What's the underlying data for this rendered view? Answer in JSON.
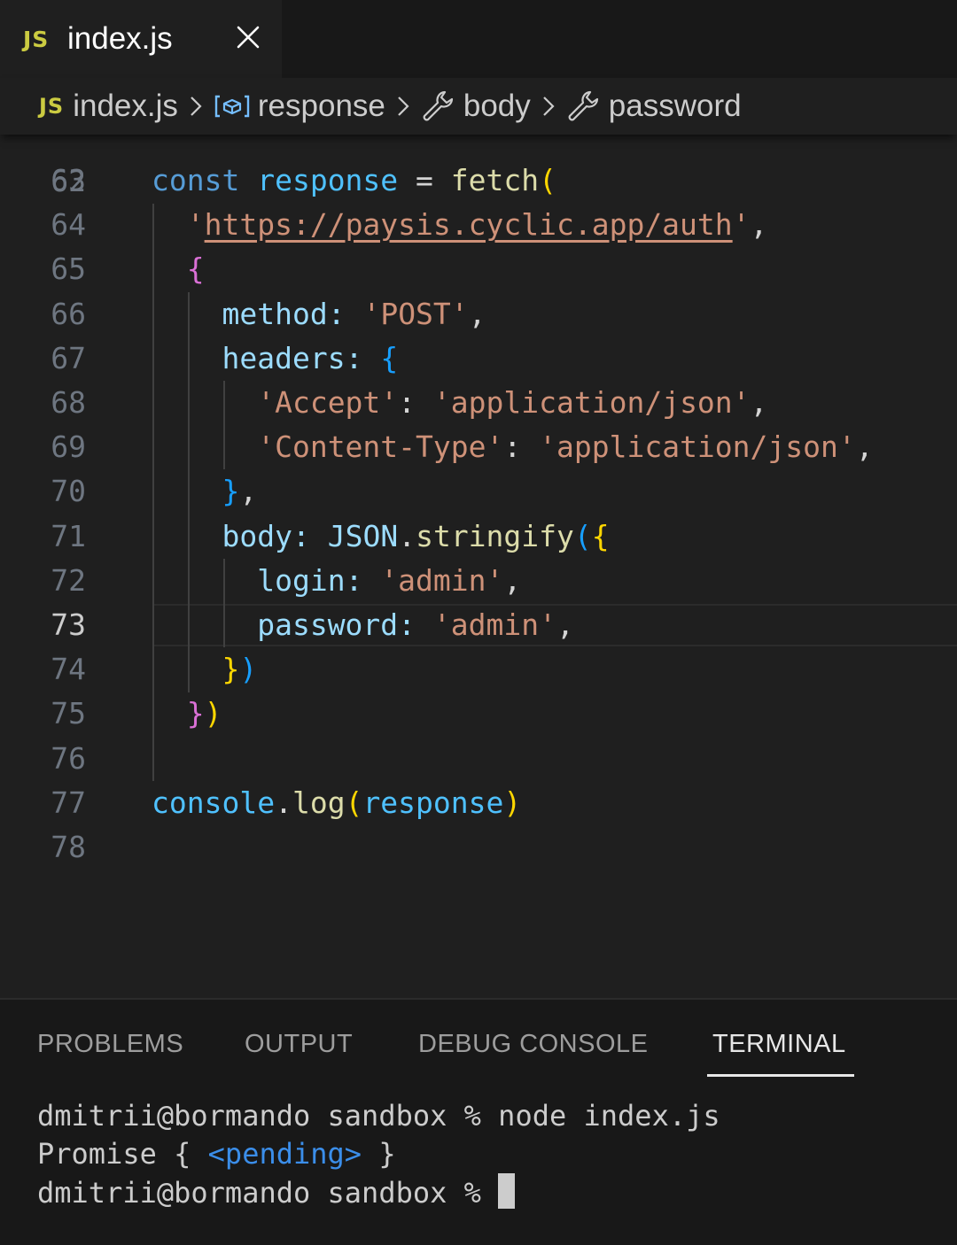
{
  "tab": {
    "icon": "js-file-icon",
    "badge": "JS",
    "title": "index.js",
    "close_icon": "close-icon"
  },
  "breadcrumb": {
    "file": {
      "badge": "JS",
      "label": "index.js"
    },
    "items": [
      {
        "icon": "variable-icon",
        "label": "response"
      },
      {
        "icon": "wrench-icon",
        "label": "body"
      },
      {
        "icon": "wrench-icon",
        "label": "password"
      }
    ],
    "separator_icon": "chevron-right-icon"
  },
  "editor": {
    "active_line": "73",
    "partial_line_number": "62",
    "lines": [
      {
        "n": "63",
        "tokens": [
          [
            "const",
            "kw"
          ],
          [
            " ",
            "pun"
          ],
          [
            "response",
            "var"
          ],
          [
            " = ",
            "pun"
          ],
          [
            "fetch",
            "fn"
          ],
          [
            "(",
            "b1"
          ]
        ]
      },
      {
        "n": "64",
        "tokens": [
          [
            "  ",
            "pun"
          ],
          [
            "'",
            "str"
          ],
          [
            "https://paysis.cyclic.app/auth",
            "str url"
          ],
          [
            "'",
            "str"
          ],
          [
            ",",
            "pun"
          ]
        ]
      },
      {
        "n": "65",
        "tokens": [
          [
            "  ",
            "pun"
          ],
          [
            "{",
            "b2"
          ]
        ]
      },
      {
        "n": "66",
        "tokens": [
          [
            "    ",
            "pun"
          ],
          [
            "method",
            "prop"
          ],
          [
            ": ",
            "prop"
          ],
          [
            "'POST'",
            "str"
          ],
          [
            ",",
            "pun"
          ]
        ]
      },
      {
        "n": "67",
        "tokens": [
          [
            "    ",
            "pun"
          ],
          [
            "headers",
            "prop"
          ],
          [
            ": ",
            "prop"
          ],
          [
            "{",
            "b3"
          ]
        ]
      },
      {
        "n": "68",
        "tokens": [
          [
            "      ",
            "pun"
          ],
          [
            "'Accept'",
            "str"
          ],
          [
            ": ",
            "pun"
          ],
          [
            "'application/json'",
            "str"
          ],
          [
            ",",
            "pun"
          ]
        ]
      },
      {
        "n": "69",
        "tokens": [
          [
            "      ",
            "pun"
          ],
          [
            "'Content-Type'",
            "str"
          ],
          [
            ": ",
            "pun"
          ],
          [
            "'application/json'",
            "str"
          ],
          [
            ",",
            "pun"
          ]
        ]
      },
      {
        "n": "70",
        "tokens": [
          [
            "    ",
            "pun"
          ],
          [
            "}",
            "b3"
          ],
          [
            ",",
            "pun"
          ]
        ]
      },
      {
        "n": "71",
        "tokens": [
          [
            "    ",
            "pun"
          ],
          [
            "body",
            "prop"
          ],
          [
            ": ",
            "prop"
          ],
          [
            "JSON",
            "obj"
          ],
          [
            ".",
            "pun"
          ],
          [
            "stringify",
            "fn"
          ],
          [
            "(",
            "b3"
          ],
          [
            "{",
            "b1"
          ]
        ]
      },
      {
        "n": "72",
        "tokens": [
          [
            "      ",
            "pun"
          ],
          [
            "login",
            "prop"
          ],
          [
            ": ",
            "prop"
          ],
          [
            "'admin'",
            "str"
          ],
          [
            ",",
            "pun"
          ]
        ]
      },
      {
        "n": "73",
        "tokens": [
          [
            "      ",
            "pun"
          ],
          [
            "password",
            "prop"
          ],
          [
            ": ",
            "prop"
          ],
          [
            "'admin'",
            "str"
          ],
          [
            ",",
            "pun"
          ]
        ]
      },
      {
        "n": "74",
        "tokens": [
          [
            "    ",
            "pun"
          ],
          [
            "}",
            "b1"
          ],
          [
            ")",
            "b3"
          ]
        ]
      },
      {
        "n": "75",
        "tokens": [
          [
            "  ",
            "pun"
          ],
          [
            "}",
            "b2"
          ],
          [
            ")",
            "b1"
          ]
        ]
      },
      {
        "n": "76",
        "tokens": []
      },
      {
        "n": "77",
        "tokens": [
          [
            "console",
            "var"
          ],
          [
            ".",
            "pun"
          ],
          [
            "log",
            "fn"
          ],
          [
            "(",
            "b1"
          ],
          [
            "response",
            "var"
          ],
          [
            ")",
            "b1"
          ]
        ]
      },
      {
        "n": "78",
        "tokens": []
      }
    ]
  },
  "panel": {
    "tabs": [
      {
        "label": "PROBLEMS",
        "active": false
      },
      {
        "label": "OUTPUT",
        "active": false
      },
      {
        "label": "DEBUG CONSOLE",
        "active": false
      },
      {
        "label": "TERMINAL",
        "active": true
      }
    ],
    "terminal": {
      "line1": "dmitrii@bormando sandbox % node index.js",
      "line2_prefix": "Promise { ",
      "line2_pending": "<pending>",
      "line2_suffix": " }",
      "line3": "dmitrii@bormando sandbox % "
    }
  },
  "colors": {
    "background": "#1f1f1f",
    "tab_bar": "#181818",
    "js_badge": "#cbcb41",
    "keyword": "#569cd6",
    "variable": "#4fc1ff",
    "function": "#dcdcaa",
    "string": "#ce9178",
    "property": "#9cdcfe",
    "bracket_gold": "#ffd700",
    "bracket_orchid": "#da70d6",
    "bracket_blue": "#179fff"
  }
}
